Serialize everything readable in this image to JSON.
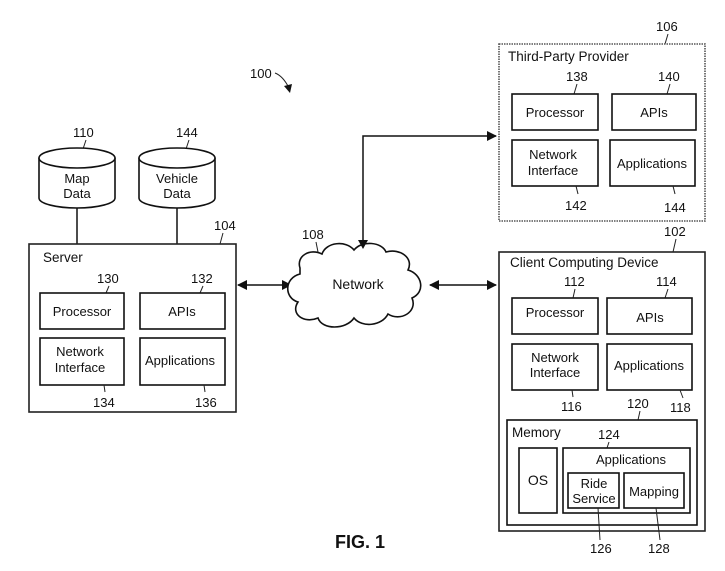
{
  "figure": {
    "label": "FIG. 1",
    "system_ref": "100"
  },
  "map_data": {
    "ref": "110",
    "line1": "Map",
    "line2": "Data"
  },
  "vehicle_data": {
    "ref": "144",
    "line1": "Vehicle",
    "line2": "Data"
  },
  "server": {
    "ref": "104",
    "title": "Server",
    "processor": {
      "label": "Processor",
      "ref": "130"
    },
    "apis": {
      "label": "APIs",
      "ref": "132"
    },
    "network_interface": {
      "line1": "Network",
      "line2": "Interface",
      "ref": "134"
    },
    "applications": {
      "label": "Applications",
      "ref": "136"
    }
  },
  "network": {
    "label": "Network",
    "ref": "108"
  },
  "third_party": {
    "ref": "106",
    "title": "Third-Party Provider",
    "processor": {
      "label": "Processor",
      "ref": "138"
    },
    "apis": {
      "label": "APIs",
      "ref": "140"
    },
    "network_interface": {
      "line1": "Network",
      "line2": "Interface",
      "ref": "142"
    },
    "applications": {
      "label": "Applications",
      "ref": "144"
    }
  },
  "client": {
    "ref": "102",
    "title": "Client Computing Device",
    "processor": {
      "label": "Processor",
      "ref": "112"
    },
    "apis": {
      "label": "APIs",
      "ref": "114"
    },
    "network_interface": {
      "line1": "Network",
      "line2": "Interface",
      "ref": "116"
    },
    "applications": {
      "label": "Applications",
      "ref": "118"
    },
    "memory": {
      "ref": "120",
      "title": "Memory",
      "os": "OS",
      "applications": {
        "ref": "124",
        "title": "Applications",
        "ride_service": {
          "line1": "Ride",
          "line2": "Service",
          "ref": "126"
        },
        "mapping": {
          "label": "Mapping",
          "ref": "128"
        }
      }
    }
  }
}
